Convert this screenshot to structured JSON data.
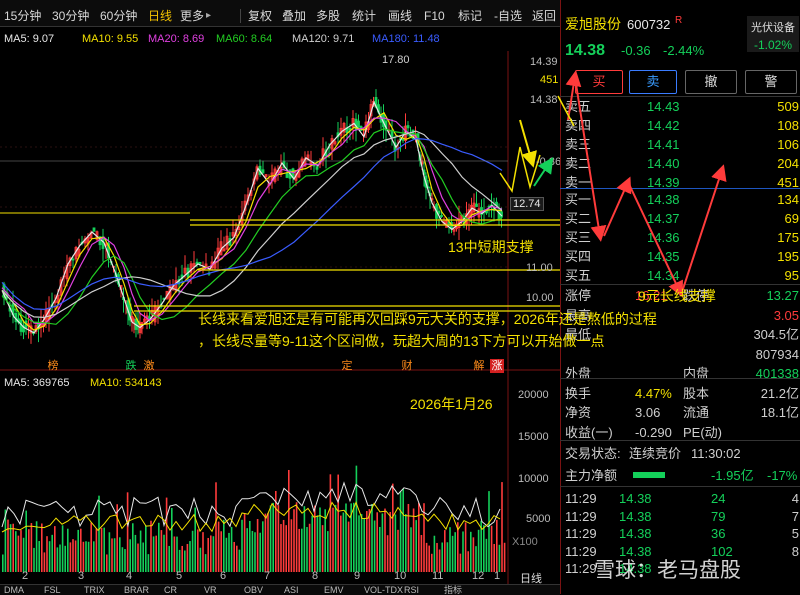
{
  "toolbar": {
    "items": [
      "15分钟",
      "30分钟",
      "60分钟",
      "日线",
      "更多",
      "复权",
      "叠加",
      "多股",
      "统计",
      "画线",
      "F10",
      "标记",
      "-自选",
      "返回"
    ],
    "active_index": 3,
    "more_arrow": "▸"
  },
  "ma_legend": [
    {
      "label": "MA5: 9.07",
      "color": "#e8e8e8"
    },
    {
      "label": "MA10: 9.55",
      "color": "#f3e000"
    },
    {
      "label": "MA20: 8.69",
      "color": "#e040e0"
    },
    {
      "label": "MA60: 8.64",
      "color": "#22cc22"
    },
    {
      "label": "MA120: 9.71",
      "color": "#cfcfcf"
    },
    {
      "label": "MA180: 11.48",
      "color": "#3a5cff"
    }
  ],
  "price_axis": {
    "ticks": [
      {
        "label": "14.39",
        "value": 14.39,
        "color": "#cfcfcf"
      },
      {
        "label": "451",
        "value": 13.9,
        "color": "#f3e000"
      },
      {
        "label": "14.38",
        "value": 13.4,
        "color": "#cfcfcf"
      },
      {
        "label": "-0.36",
        "value": 12.9,
        "color": "#cfcfcf"
      },
      {
        "label": "12.74",
        "value": 12.74,
        "color": "#cfcfcf"
      },
      {
        "label": "11.00",
        "value": 11.0,
        "color": "#888888"
      },
      {
        "label": "10.00",
        "value": 10.0,
        "color": "#888888"
      }
    ],
    "high_label": "17.80",
    "current_marker": "12.74"
  },
  "volume_axis": {
    "ticks": [
      "20000",
      "15000",
      "10000",
      "5000"
    ],
    "unit": "X100",
    "legend": [
      {
        "label": "MA5: 369765",
        "color": "#e8e8e8"
      },
      {
        "label": "MA10: 534143",
        "color": "#f3e000"
      }
    ]
  },
  "months": [
    "2",
    "3",
    "4",
    "5",
    "6",
    "7",
    "8",
    "9",
    "10",
    "11",
    "12",
    "1"
  ],
  "events": [
    {
      "text": "榜",
      "color": "#ff8c1a"
    },
    {
      "text": "跌",
      "color": "#14d05a"
    },
    {
      "text": "激",
      "color": "#ff8c1a"
    },
    {
      "text": "定",
      "color": "#ff8c1a"
    },
    {
      "text": "财",
      "color": "#ff8c1a"
    },
    {
      "text": "解",
      "color": "#ff8c1a"
    },
    {
      "text": "涨",
      "color": "#ff3b3b"
    }
  ],
  "annotations": {
    "short_support": "13中短期支撑",
    "long_support": "9元长线支撑",
    "commentary_line1": "长线来看爱旭还是有可能再次回踩9元大关的支撑，2026年还是熬低的过程",
    "commentary_line2": "，长线尽量等9-11这个区间做，玩超大周的13下方可以开始做一点",
    "date": "2026年1月26"
  },
  "stock": {
    "name": "爱旭股份",
    "code": "600732",
    "badge": "R",
    "sector": "光伏设备",
    "sector_change": "-1.02%",
    "price": "14.38",
    "change": "-0.36",
    "change_pct": "-2.44%"
  },
  "trade_buttons": [
    "买",
    "卖",
    "撤",
    "警"
  ],
  "order_book": {
    "asks": [
      {
        "label": "卖五",
        "price": "14.43",
        "volume": "509"
      },
      {
        "label": "卖四",
        "price": "14.42",
        "volume": "108"
      },
      {
        "label": "卖三",
        "price": "14.41",
        "volume": "106"
      },
      {
        "label": "卖二",
        "price": "14.40",
        "volume": "204"
      },
      {
        "label": "卖一",
        "price": "14.39",
        "volume": "451"
      }
    ],
    "bids": [
      {
        "label": "买一",
        "price": "14.38",
        "volume": "134"
      },
      {
        "label": "买二",
        "price": "14.37",
        "volume": "69"
      },
      {
        "label": "买三",
        "price": "14.36",
        "volume": "175"
      },
      {
        "label": "买四",
        "price": "14.35",
        "volume": "195"
      },
      {
        "label": "买五",
        "price": "14.34",
        "volume": "95"
      }
    ]
  },
  "stats": [
    {
      "l1": "涨停",
      "v1": "16.21",
      "v1c": "#ff3b3b",
      "l2": "跌停",
      "v2": "13.27",
      "v2c": "#14d05a"
    },
    {
      "l1": "最高",
      "v1": "",
      "v1c": "#ff3b3b",
      "l2": "",
      "v2": "3.05",
      "v2c": "#ff3b3b"
    },
    {
      "l1": "最低",
      "v1": "",
      "v1c": "#14d05a",
      "l2": "",
      "v2": "304.5亿",
      "v2c": "#cfcfcf"
    },
    {
      "l1": "",
      "v1": "",
      "v1c": "#cfcfcf",
      "l2": "",
      "v2": "807934",
      "v2c": "#cfcfcf"
    },
    {
      "l1": "外盘",
      "v1": "",
      "v1c": "#ff3b3b",
      "l2": "内盘",
      "v2": "401338",
      "v2c": "#14d05a"
    },
    {
      "l1": "换手",
      "v1": "4.47%",
      "v1c": "#f3e000",
      "l2": "股本",
      "v2": "21.2亿",
      "v2c": "#cfcfcf"
    },
    {
      "l1": "净资",
      "v1": "3.06",
      "v1c": "#cfcfcf",
      "l2": "流通",
      "v2": "18.1亿",
      "v2c": "#cfcfcf"
    },
    {
      "l1": "收益(一)",
      "v1": "-0.290",
      "v1c": "#cfcfcf",
      "l2": "PE(动)",
      "v2": "",
      "v2c": "#cfcfcf"
    }
  ],
  "trade_status": {
    "label": "交易状态:",
    "value": "连续竞价",
    "time": "11:30:02"
  },
  "main_flow": {
    "label": "主力净额",
    "value": "-1.95亿",
    "pct": "-17%"
  },
  "ticks": [
    {
      "time": "11:29",
      "price": "14.38",
      "vol": "24",
      "count": "4"
    },
    {
      "time": "11:29",
      "price": "14.38",
      "vol": "79",
      "count": "7"
    },
    {
      "time": "11:29",
      "price": "14.38",
      "vol": "36",
      "count": "5"
    },
    {
      "time": "11:29",
      "price": "14.38",
      "vol": "102",
      "count": "8"
    },
    {
      "time": "11:29",
      "price": "14.38",
      "vol": "",
      "count": ""
    }
  ],
  "bottom_tabs": [
    "DMA",
    "FSL",
    "TRIX",
    "BRAR",
    "CR",
    "VR",
    "OBV",
    "ASI",
    "EMV",
    "VOL-TDX",
    "RSI",
    "指标"
  ],
  "period_label": "日线",
  "watermark": "雪球：老马盘股",
  "chart_data": {
    "type": "candlestick",
    "x": [
      "2",
      "3",
      "4",
      "5",
      "6",
      "7",
      "8",
      "9",
      "10",
      "11",
      "12",
      "1"
    ],
    "close_monthly": [
      9.4,
      11.2,
      9.7,
      10.4,
      11.6,
      13.6,
      15.8,
      16.9,
      14.8,
      13.3,
      13.1,
      12.74
    ],
    "high_marked": 17.8,
    "ma_last": {
      "MA5": 9.07,
      "MA10": 9.55,
      "MA20": 8.69,
      "MA60": 8.64,
      "MA120": 9.71,
      "MA180": 11.48
    },
    "support_levels": [
      13,
      11,
      9
    ],
    "volume_ma_last": {
      "MA5": 369765,
      "MA10": 534143
    }
  },
  "colors": {
    "up": "#ff3b3b",
    "down": "#14d05a",
    "accent": "#f3e000",
    "bg": "#000000"
  }
}
